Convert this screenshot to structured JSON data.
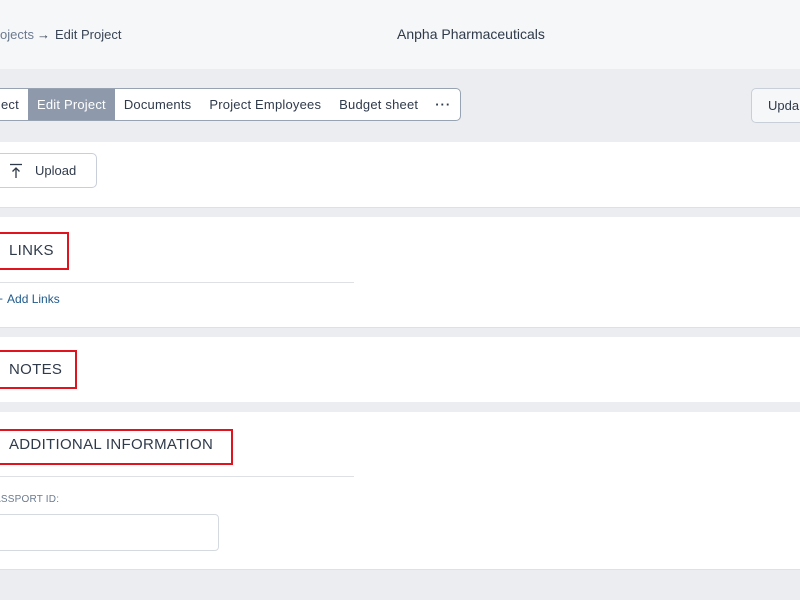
{
  "header": {
    "breadcrumb": {
      "parent": "ojects",
      "separator": "→",
      "current": "Edit Project"
    },
    "company": "Anpha Pharmaceuticals"
  },
  "tabs": {
    "items": [
      {
        "label": "ect",
        "active": false
      },
      {
        "label": "Edit Project",
        "active": true
      },
      {
        "label": "Documents",
        "active": false
      },
      {
        "label": "Project Employees",
        "active": false
      },
      {
        "label": "Budget sheet",
        "active": false
      }
    ],
    "more_label": "···"
  },
  "toolbar": {
    "update_label": "Upda"
  },
  "upload": {
    "label": "Upload",
    "icon": "upload-icon"
  },
  "sections": {
    "links": {
      "title": "LINKS",
      "add_label": "Add Links"
    },
    "notes": {
      "title": "NOTES"
    },
    "additional_info": {
      "title": "ADDITIONAL INFORMATION",
      "passport_label": "ASSPORT ID:",
      "passport_value": ""
    }
  },
  "colors": {
    "highlight": "#e0141e",
    "active_tab": "#8e9aab",
    "link": "#1e5a8c"
  }
}
